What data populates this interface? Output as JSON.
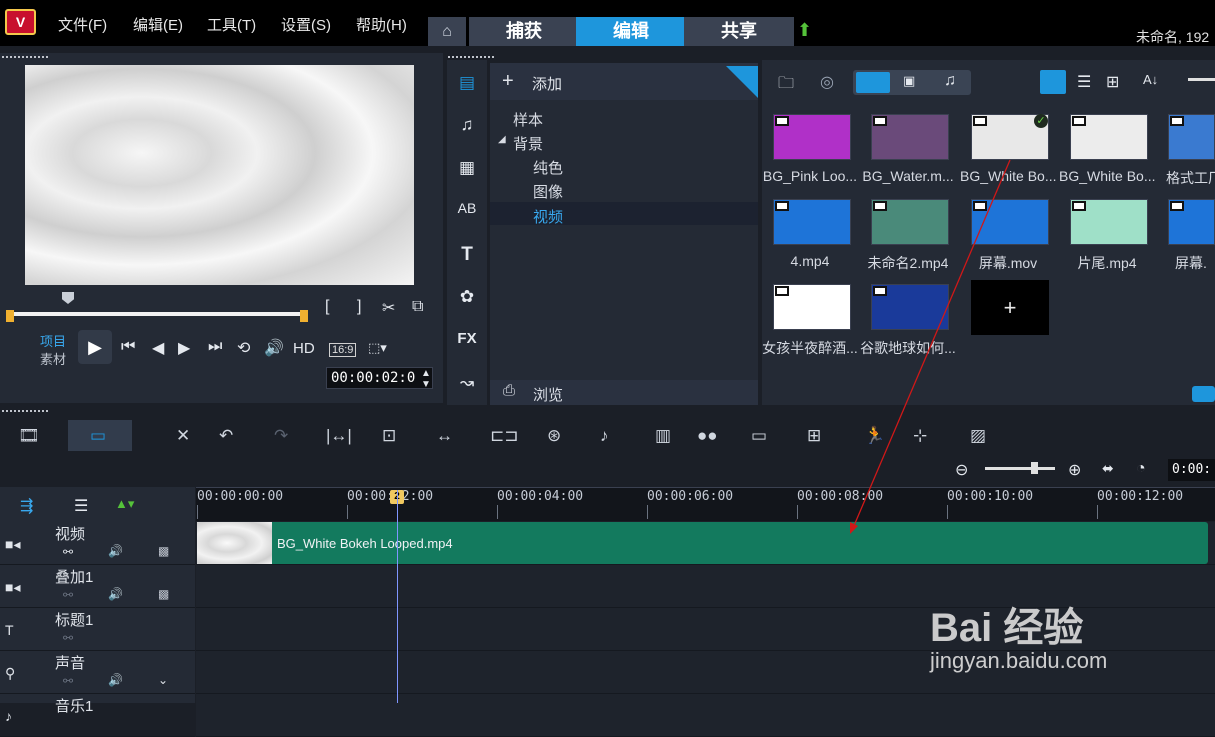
{
  "menu": {
    "file": "文件(F)",
    "edit": "编辑(E)",
    "tools": "工具(T)",
    "settings": "设置(S)",
    "help": "帮助(H)"
  },
  "tabs": {
    "home_icon": "home-icon",
    "capture": "捕获",
    "edit": "编辑",
    "share": "共享"
  },
  "project_title": "未命名, 192",
  "player": {
    "project_label": "项目",
    "clip_label": "素材",
    "hd_label": "HD",
    "aspect": "16:9",
    "timecode": "00:00:02:0",
    "bracket_in": "[",
    "bracket_out": "]"
  },
  "library": {
    "add_label": "添加",
    "browse_label": "浏览",
    "tree": {
      "sample": "样本",
      "background": "背景",
      "solid": "纯色",
      "image": "图像",
      "video": "视频"
    },
    "side_icons": {
      "fx": "FX"
    },
    "thumbnails": [
      {
        "name": "BG_Pink Loo...",
        "color": "#b030c8"
      },
      {
        "name": "BG_Water.m...",
        "color": "#6a4a7a"
      },
      {
        "name": "BG_White Bo...",
        "color": "#e8e8e8"
      },
      {
        "name": "BG_White Bo...",
        "color": "#ececec"
      },
      {
        "name": "格式工厂",
        "color": "#3a7ad0"
      },
      {
        "name": "4.mp4",
        "color": "#1e74d8"
      },
      {
        "name": "未命名2.mp4",
        "color": "#4a8a7a"
      },
      {
        "name": "屏幕.mov",
        "color": "#1e74d8"
      },
      {
        "name": "片尾.mp4",
        "color": "#9fe0c8"
      },
      {
        "name": "屏幕.",
        "color": "#1e74d8"
      },
      {
        "name": "女孩半夜醉酒...",
        "color": "#ffffff"
      },
      {
        "name": "谷歌地球如何...",
        "color": "#1a3a9a"
      }
    ],
    "add_thumb": "+"
  },
  "timeline": {
    "ruler": [
      "00:00:00:00",
      "00:00:02:00",
      "00:00:04:00",
      "00:00:06:00",
      "00:00:08:00",
      "00:00:10:00",
      "00:00:12:00"
    ],
    "zoom_time": "0:00:",
    "tracks": [
      {
        "name": "视频"
      },
      {
        "name": "叠加1"
      },
      {
        "name": "标题1"
      },
      {
        "name": "声音"
      },
      {
        "name": "音乐1"
      }
    ],
    "clip_name": "BG_White Bokeh Looped.mp4",
    "marker": "2"
  },
  "watermark": {
    "line1": "Bai 经验",
    "line2": "jingyan.baidu.com"
  },
  "colors": {
    "accent": "#1e96dc",
    "clip": "#137a5e",
    "annotation_arrow": "#d01818"
  }
}
